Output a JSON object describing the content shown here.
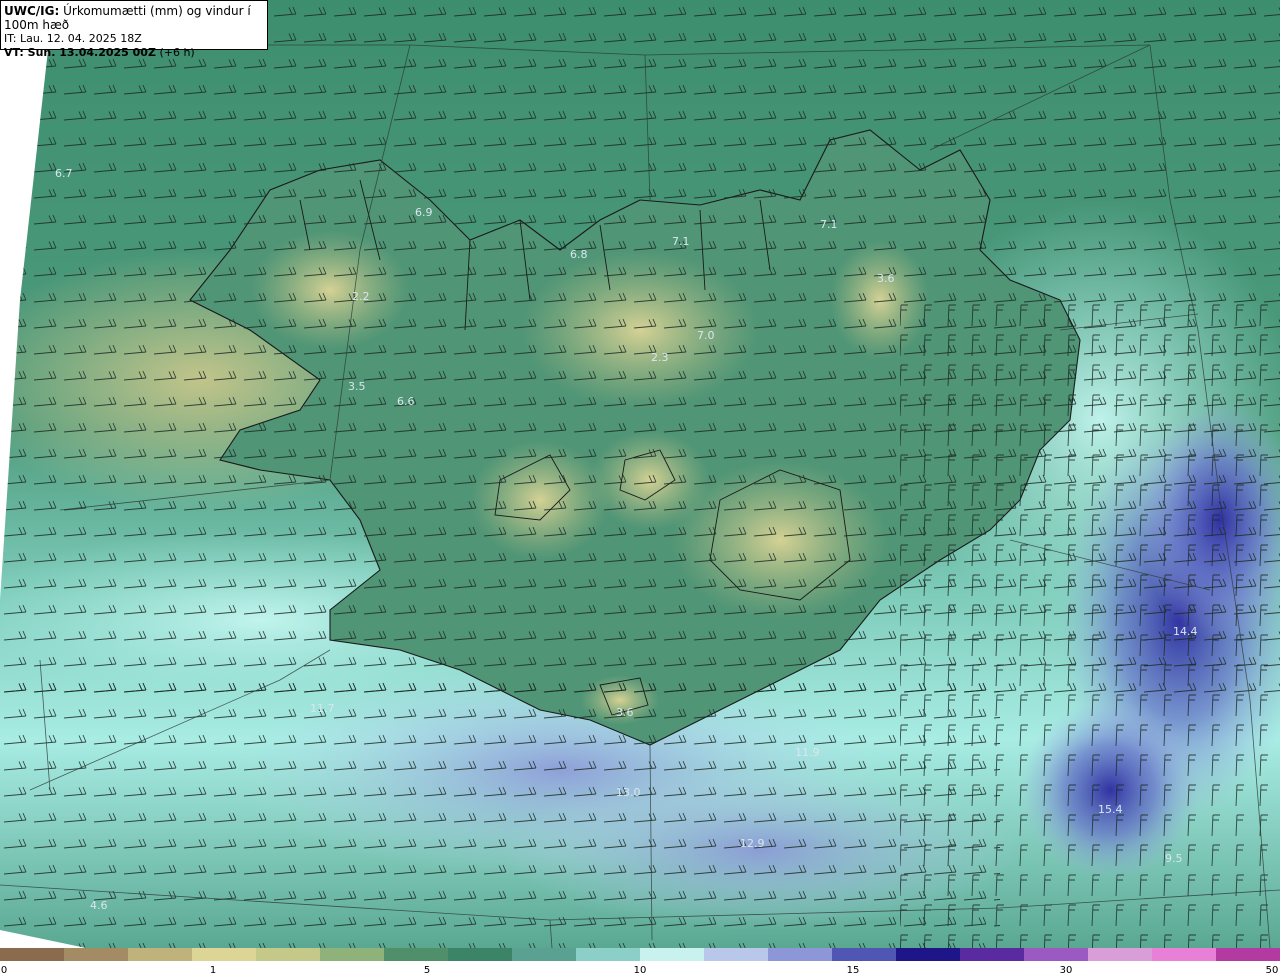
{
  "header": {
    "product": "UWC/IG:",
    "title": "Úrkomumætti (mm) og vindur í 100m hæð",
    "init_time": "IT: Lau. 12. 04. 2025 18Z",
    "valid_prefix": "VT: Sun. 13.04.2025 00Z",
    "valid_suffix": "(+6 h)"
  },
  "map_values": [
    {
      "value": "6.7"
    },
    {
      "value": "6.9"
    },
    {
      "value": "6.8"
    },
    {
      "value": "7.1"
    },
    {
      "value": "7.1"
    },
    {
      "value": "3.6"
    },
    {
      "value": "2.2"
    },
    {
      "value": "7.0"
    },
    {
      "value": "2.3"
    },
    {
      "value": "3.5"
    },
    {
      "value": "6.6"
    },
    {
      "value": "11.7"
    },
    {
      "value": "3.6"
    },
    {
      "value": "11.9"
    },
    {
      "value": "13.0"
    },
    {
      "value": "12.9"
    },
    {
      "value": "14.4"
    },
    {
      "value": "15.4"
    },
    {
      "value": "9.5"
    },
    {
      "value": "4.6"
    }
  ],
  "colorbar": {
    "ticks": [
      "0",
      "1",
      "5",
      "10",
      "15",
      "30",
      "50"
    ],
    "colors": [
      "#8a6b4e",
      "#a38c64",
      "#bfb27a",
      "#dcd596",
      "#c4c98a",
      "#8fb27a",
      "#4f8f6a",
      "#3c8468",
      "#5aa192",
      "#8ccfc8",
      "#c9f2ee",
      "#b9c8ea",
      "#8d96d6",
      "#5056b4",
      "#1e1688",
      "#5a2aa0",
      "#9a5ac2",
      "#d99ed8",
      "#e880d8",
      "#b23aa0"
    ]
  },
  "colors": {
    "sea_dark": "#3a8a6c",
    "land_low": "#4a9070",
    "land_high": "#d6d08e",
    "rain_light": "#aaf0ea",
    "rain_mid": "#9aa8e0",
    "rain_heavy": "#2a2a9c",
    "coast": "#1a1a1a",
    "label": "#d9e6ee"
  }
}
